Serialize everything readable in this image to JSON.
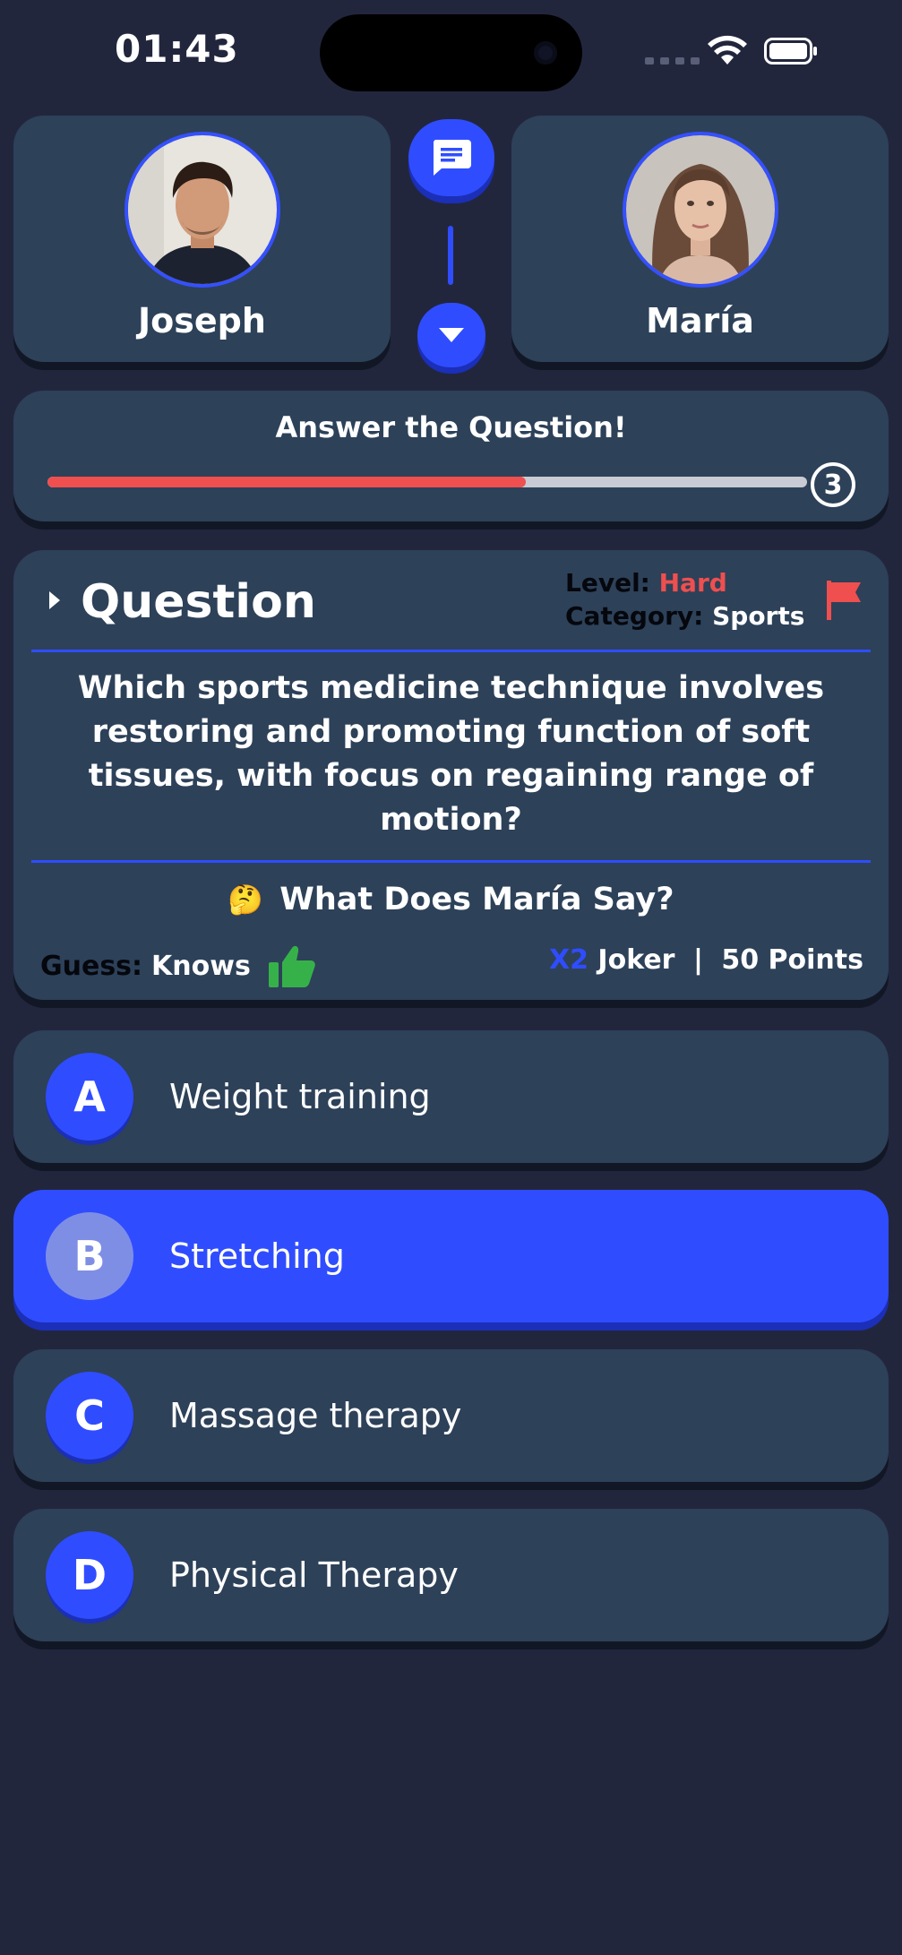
{
  "status_bar": {
    "time": "01:43"
  },
  "players": {
    "left": {
      "name": "Joseph"
    },
    "right": {
      "name": "María"
    }
  },
  "timer": {
    "title": "Answer the Question!",
    "seconds": "3",
    "progress": 0.63
  },
  "question": {
    "heading": "Question",
    "level_label": "Level:",
    "level_value": "Hard",
    "category_label": "Category:",
    "category_value": "Sports",
    "text": "Which sports medicine technique involves restoring and promoting function of soft tissues, with focus on regaining range of motion?",
    "guess_prompt": "What Does María Say?",
    "guess_emoji": "🤔",
    "guess_label": "Guess:",
    "guess_value": "Knows",
    "joker_multiplier": "X2",
    "joker_label": "Joker",
    "separator": "|",
    "points": "50 Points"
  },
  "answers": [
    {
      "letter": "A",
      "text": "Weight training",
      "selected": false
    },
    {
      "letter": "B",
      "text": "Stretching",
      "selected": true
    },
    {
      "letter": "C",
      "text": "Massage therapy",
      "selected": false
    },
    {
      "letter": "D",
      "text": "Physical Therapy",
      "selected": false
    }
  ],
  "colors": {
    "background": "#22263d",
    "card": "#2d4159",
    "accent": "#2f4dff",
    "danger": "#ef4f4f",
    "thumb": "#36b14a"
  }
}
